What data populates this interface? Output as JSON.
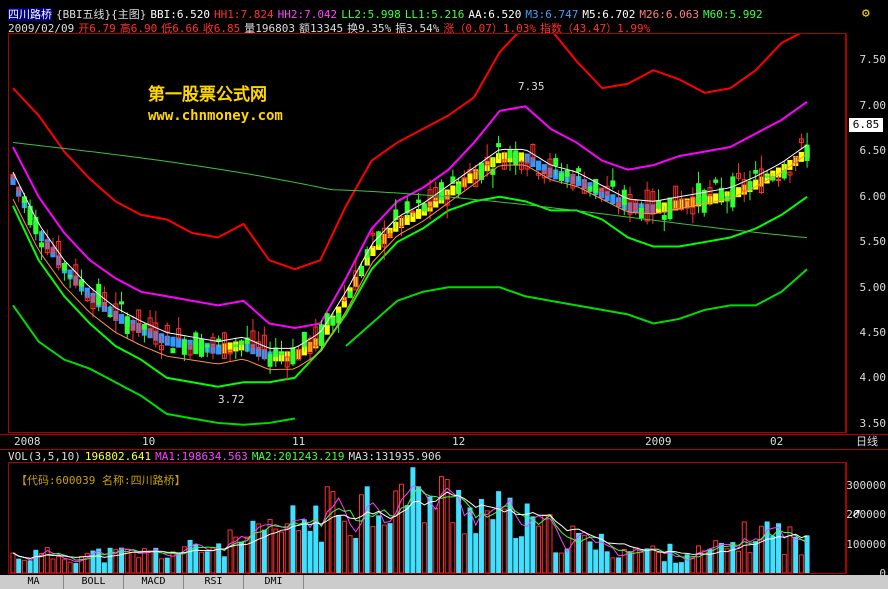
{
  "header": {
    "stock": "四川路桥",
    "formula": "{BBI五线}{主图}",
    "bbi": "BBI:6.520",
    "hh1": "HH1:7.824",
    "hh2": "HH2:7.042",
    "ll2": "LL2:5.998",
    "ll1": "LL1:5.216",
    "aa": "AA:6.520",
    "m3": "M3:6.747",
    "m5": "M5:6.702",
    "m26": "M26:6.063",
    "m60": "M60:5.992"
  },
  "quote": {
    "date": "2009/02/09",
    "open": "开6.79",
    "high": "高6.90",
    "low": "低6.66",
    "close": "收6.85",
    "volume": "量196803",
    "amount": "额13345",
    "turnover": "换9.35%",
    "amplitude": "振3.54%",
    "change": "涨（0.07）1.03%",
    "index": "指数（43.47）1.99%"
  },
  "watermark": {
    "line1": "第一股票公式网",
    "line2": "www.chnmoney.com"
  },
  "annotations": {
    "high": "7.35",
    "low": "3.72"
  },
  "price_axis": [
    "7.50",
    "7.00",
    "6.50",
    "6.00",
    "5.50",
    "5.00",
    "4.50",
    "4.00",
    "3.50"
  ],
  "price_tag": "6.85",
  "date_axis": [
    "2008",
    "10",
    "11",
    "12",
    "2009",
    "02"
  ],
  "period": "日线",
  "volume_header": {
    "label": "VOL(3,5,10)",
    "vol": "196802.641",
    "ma1": "MA1:198634.563",
    "ma2": "MA2:201243.219",
    "ma3": "MA3:131935.906"
  },
  "info_box": "【代码:600039 名称:四川路桥】",
  "volume_axis": [
    "300000",
    "200000",
    "100000",
    "0"
  ],
  "tabs": [
    "MA",
    "BOLL",
    "MACD",
    "RSI",
    "DMI"
  ],
  "colors": {
    "up": "#ff3030",
    "down": "#30ff30",
    "bbi_up": "#ffff00",
    "bbi_down": "#3399ff",
    "hh1": "#ff0000",
    "hh2": "#ff00ff",
    "ll1": "#00dd00",
    "ll2": "#00ff00"
  },
  "chart_data": {
    "type": "line",
    "series": [
      {
        "name": "HH1",
        "values": [
          7.2,
          6.9,
          6.5,
          6.2,
          5.95,
          5.8,
          5.75,
          5.6,
          5.55,
          5.7,
          5.3,
          5.2,
          5.3,
          5.9,
          6.4,
          6.6,
          6.75,
          6.9,
          7.1,
          7.6,
          7.9,
          7.85,
          7.5,
          7.2,
          7.25,
          7.4,
          7.3,
          7.15,
          7.2,
          7.4,
          7.7,
          7.85
        ]
      },
      {
        "name": "HH2",
        "values": [
          6.55,
          6.0,
          5.6,
          5.3,
          5.1,
          4.95,
          4.9,
          4.85,
          4.8,
          4.85,
          4.6,
          4.55,
          4.6,
          5.1,
          5.65,
          5.95,
          6.1,
          6.3,
          6.6,
          6.95,
          7.0,
          6.75,
          6.6,
          6.4,
          6.3,
          6.35,
          6.45,
          6.5,
          6.55,
          6.7,
          6.85,
          7.05
        ]
      },
      {
        "name": "LL2",
        "values": [
          5.9,
          5.3,
          4.9,
          4.6,
          4.35,
          4.2,
          4.0,
          3.95,
          3.9,
          3.95,
          3.95,
          4.0,
          4.3,
          4.7,
          5.2,
          5.5,
          5.65,
          5.85,
          5.95,
          6.0,
          5.95,
          5.85,
          5.85,
          5.75,
          5.55,
          5.45,
          5.45,
          5.5,
          5.55,
          5.65,
          5.8,
          6.0
        ]
      },
      {
        "name": "LL1",
        "values": [
          4.8,
          4.4,
          4.2,
          4.1,
          3.95,
          3.8,
          3.6,
          3.55,
          3.5,
          3.48,
          3.5,
          3.55,
          null,
          4.35,
          4.6,
          4.85,
          4.95,
          5.0,
          5.0,
          5.0,
          4.9,
          4.85,
          4.8,
          4.75,
          4.7,
          4.6,
          4.65,
          4.75,
          4.8,
          4.8,
          4.95,
          5.2
        ]
      }
    ],
    "ylim": [
      3.4,
      7.8
    ]
  }
}
